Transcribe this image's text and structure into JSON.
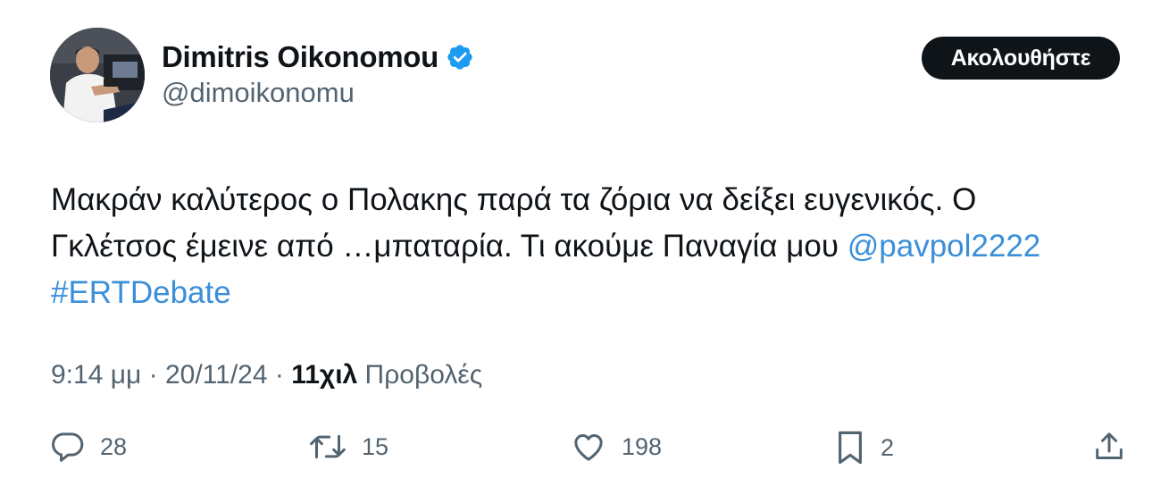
{
  "author": {
    "name": "Dimitris Oikonomou",
    "handle": "@dimoikonomu",
    "verified": true,
    "avatar": "avatar-photo"
  },
  "follow_button": {
    "label": "Ακολουθήστε"
  },
  "tweet": {
    "line1": "Μακράν καλύτερος ο Πολακης παρά τα ζόρια να δείξει ευγενικός. Ο",
    "line2_text": "Γκλέτσος έμεινε από …μπαταρία. Τι ακούμε Παναγία μου ",
    "mention": "@pavpol2222",
    "hashtag": "#ERTDebate"
  },
  "meta": {
    "time": "9:14 μμ",
    "separator1": " · ",
    "date": "20/11/24",
    "separator2": " · ",
    "views_count": "11χιλ",
    "views_label": " Προβολές"
  },
  "actions": {
    "reply": {
      "icon": "reply-icon",
      "count": "28"
    },
    "retweet": {
      "icon": "retweet-icon",
      "count": "15"
    },
    "like": {
      "icon": "heart-icon",
      "count": "198"
    },
    "bookmark": {
      "icon": "bookmark-icon",
      "count": "2"
    },
    "share": {
      "icon": "share-icon"
    }
  },
  "colors": {
    "text": "#0f1419",
    "secondary": "#536471",
    "link": "#3b8fd9",
    "verified": "#1d9bf0",
    "button_bg": "#0f1419",
    "button_text": "#ffffff"
  }
}
